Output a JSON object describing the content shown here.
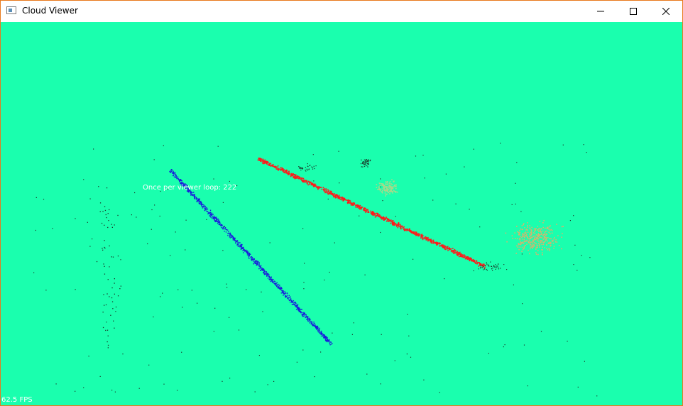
{
  "window": {
    "title": "Cloud Viewer",
    "controls": {
      "minimize_icon": "minimize-icon",
      "maximize_icon": "maximize-icon",
      "close_icon": "close-icon"
    },
    "border_color": "#e8781c"
  },
  "viewer": {
    "background_color": "#1affae",
    "overlay_text": "Once per viewer loop: 222",
    "fps_text": "62.5 FPS"
  },
  "point_clouds": [
    {
      "name": "blue-line",
      "color": "#1a1adc"
    },
    {
      "name": "red-line",
      "color": "#ff1a1a"
    },
    {
      "name": "orange-cluster",
      "color": "#d4b56e"
    },
    {
      "name": "light-cluster",
      "color": "#a8d98a"
    },
    {
      "name": "dark-points",
      "color": "#1a3a2a"
    }
  ]
}
